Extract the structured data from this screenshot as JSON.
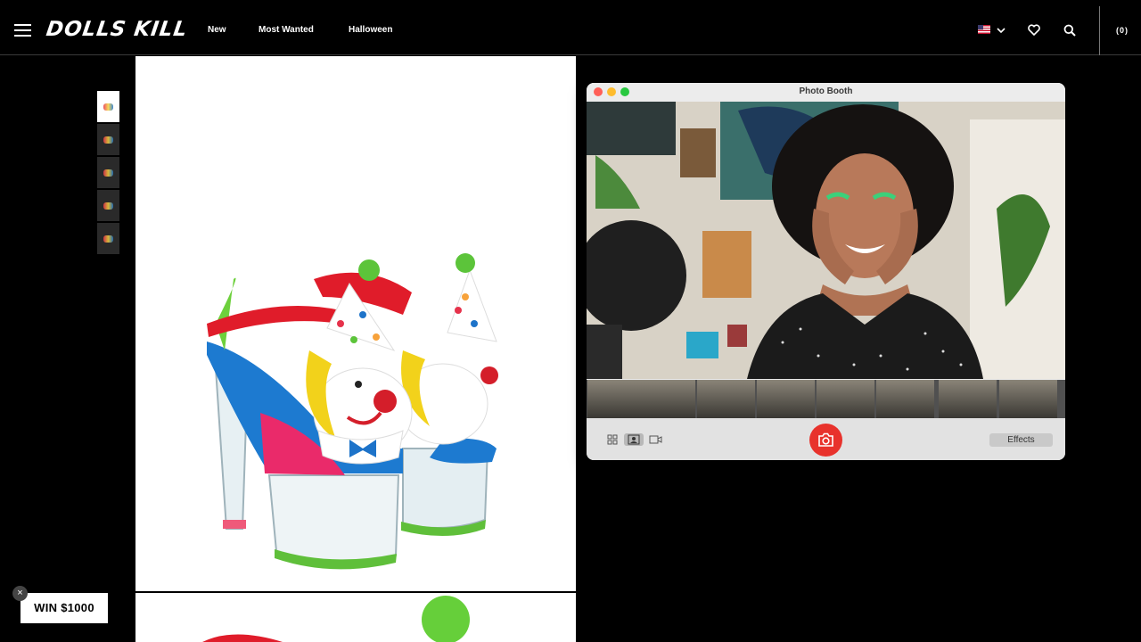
{
  "header": {
    "logo": "DOLLS KILL",
    "nav": [
      "New",
      "Most Wanted",
      "Halloween"
    ],
    "cart": "(0)"
  },
  "icons": {
    "menu": "hamburger-icon",
    "flag": "us-flag-icon",
    "dropdown": "chevron-down-icon",
    "wishlist": "heart-icon",
    "search": "search-icon"
  },
  "thumbnails": [
    {
      "state": "active"
    },
    {
      "state": "inactive"
    },
    {
      "state": "inactive"
    },
    {
      "state": "inactive"
    },
    {
      "state": "inactive"
    }
  ],
  "photo_booth": {
    "title": "Photo Booth",
    "effects_label": "Effects",
    "view_modes": [
      "grid-view-icon",
      "single-photo-icon",
      "video-icon"
    ],
    "strip_count": 8
  },
  "promo": {
    "close": "×",
    "label": "WIN $1000"
  },
  "colors": {
    "background": "#000000",
    "shutter": "#e8322c",
    "panel": "#ffffff"
  }
}
